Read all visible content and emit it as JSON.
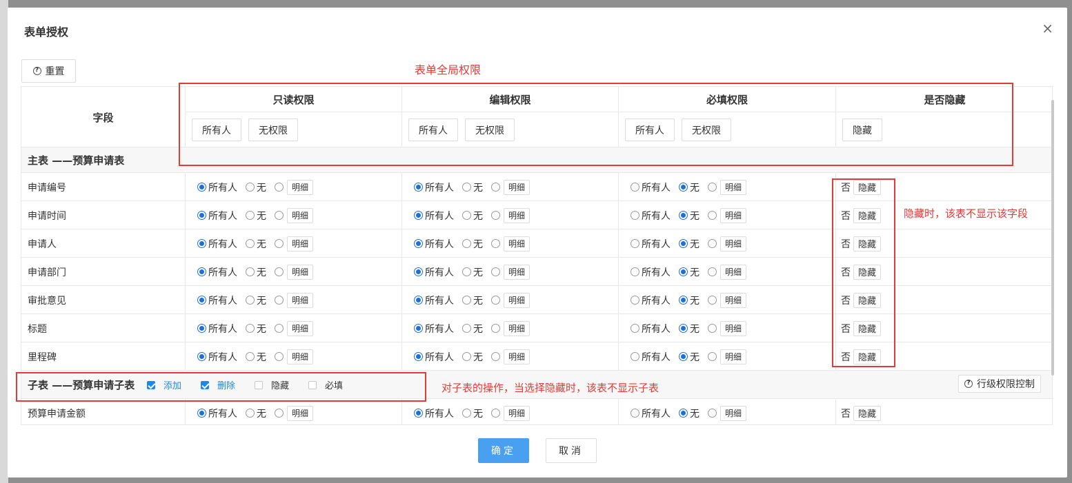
{
  "dialog": {
    "title": "表单授权",
    "close": "×"
  },
  "toolbar": {
    "reset_label": "重置"
  },
  "annotations": {
    "global": "表单全局权限",
    "hide": "隐藏时，该表不显示该字段",
    "subtable": "对子表的操作，当选择隐藏时，该表不显示子表"
  },
  "header": {
    "field": "字段",
    "groups": [
      {
        "title": "只读权限",
        "buttons": [
          "所有人",
          "无权限"
        ]
      },
      {
        "title": "编辑权限",
        "buttons": [
          "所有人",
          "无权限"
        ]
      },
      {
        "title": "必填权限",
        "buttons": [
          "所有人",
          "无权限"
        ]
      },
      {
        "title": "是否隐藏",
        "buttons": [
          "隐藏"
        ]
      }
    ]
  },
  "labels": {
    "all": "所有人",
    "none": "无",
    "detail": "明细",
    "no": "否",
    "hide": "隐藏"
  },
  "main_section": {
    "title": "主表 ——预算申请表"
  },
  "rows": [
    {
      "name": "申请编号",
      "read": "all",
      "edit": "all",
      "required": "none"
    },
    {
      "name": "申请时间",
      "read": "all",
      "edit": "all",
      "required": "none"
    },
    {
      "name": "申请人",
      "read": "all",
      "edit": "all",
      "required": "none"
    },
    {
      "name": "申请部门",
      "read": "all",
      "edit": "all",
      "required": "none"
    },
    {
      "name": "审批意见",
      "read": "all",
      "edit": "all",
      "required": "none"
    },
    {
      "name": "标题",
      "read": "all",
      "edit": "all",
      "required": "none"
    },
    {
      "name": "里程碑",
      "read": "all",
      "edit": "all",
      "required": "none"
    }
  ],
  "sub_section": {
    "title": "子表 ——预算申请子表",
    "options": [
      {
        "label": "添加",
        "checked": true
      },
      {
        "label": "删除",
        "checked": true
      },
      {
        "label": "隐藏",
        "checked": false
      },
      {
        "label": "必填",
        "checked": false
      }
    ],
    "row_control_label": "行级权限控制"
  },
  "sub_rows": [
    {
      "name": "预算申请金额",
      "read": "all",
      "edit": "all",
      "required": "none"
    }
  ],
  "footer": {
    "ok_label": "确定",
    "cancel_label": "取消"
  },
  "colors": {
    "primary": "#4aa0f0",
    "annotation": "#e53935",
    "radio_on": "#1e6fd9"
  }
}
